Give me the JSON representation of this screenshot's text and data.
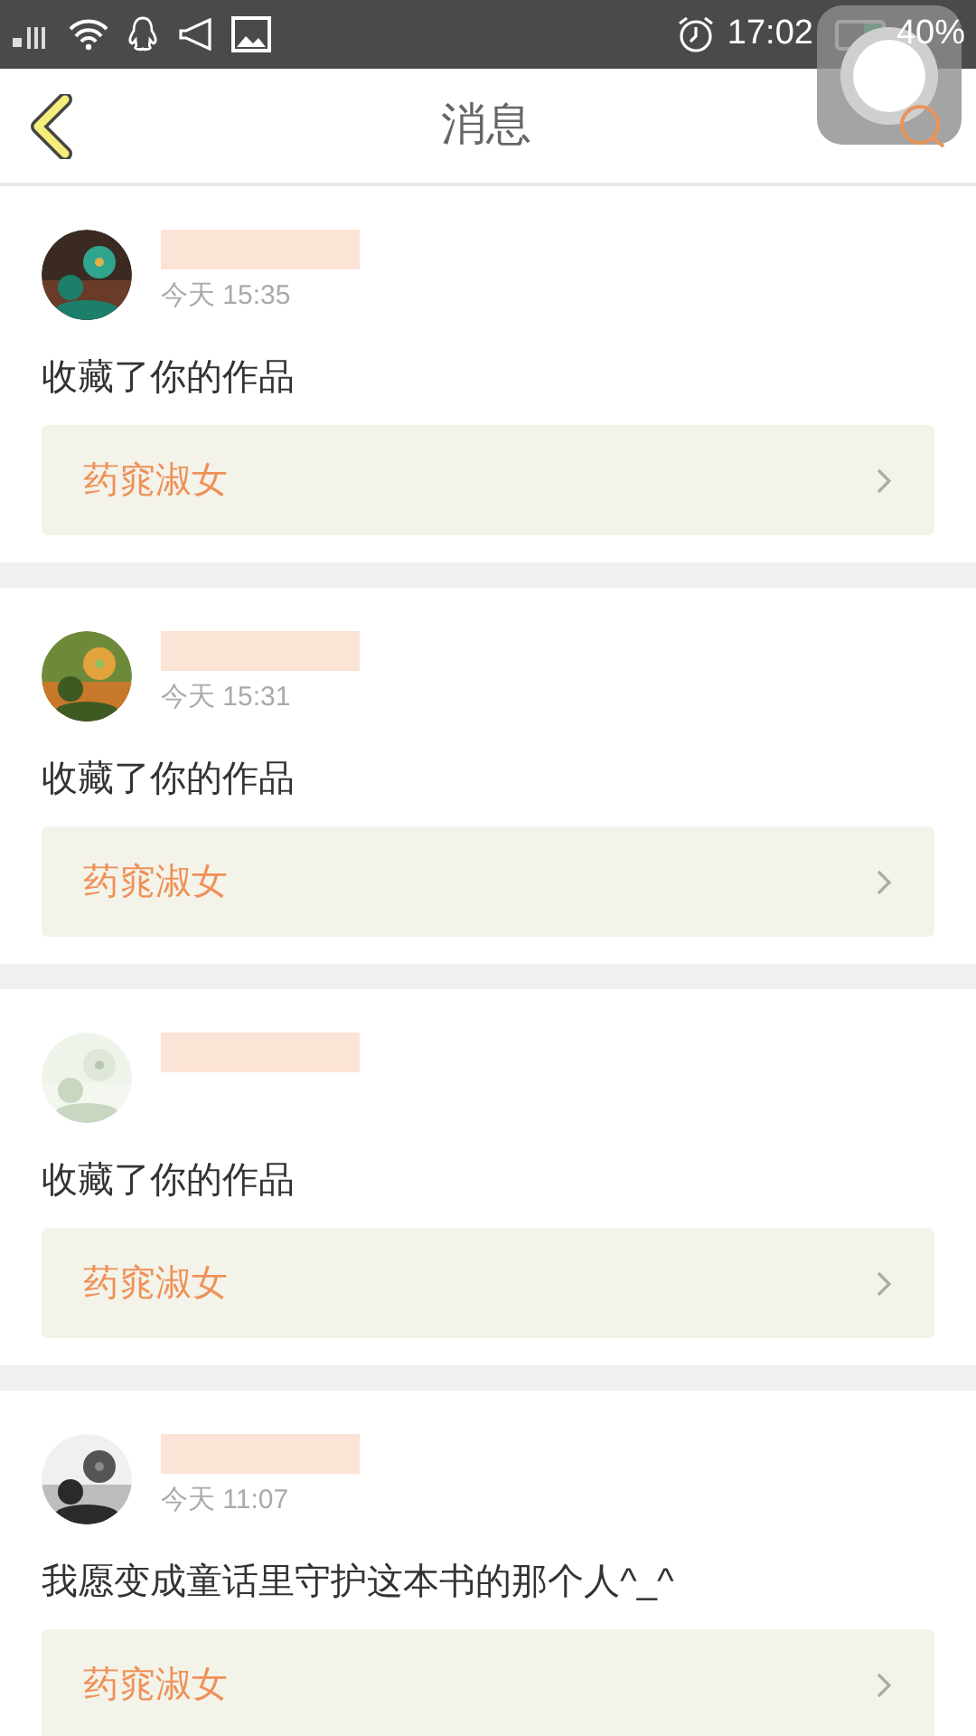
{
  "status_bar": {
    "time": "17:02",
    "battery_text": "40%"
  },
  "header": {
    "title": "消息"
  },
  "messages": [
    {
      "time": "今天 15:35",
      "text": "收藏了你的作品",
      "work": "药窕淑女"
    },
    {
      "time": "今天 15:31",
      "text": "收藏了你的作品",
      "work": "药窕淑女"
    },
    {
      "text": "收藏了你的作品",
      "work": "药窕淑女"
    },
    {
      "time": "今天 11:07",
      "text": "我愿变成童话里守护这本书的那个人^_^",
      "work": "药窕淑女"
    }
  ]
}
